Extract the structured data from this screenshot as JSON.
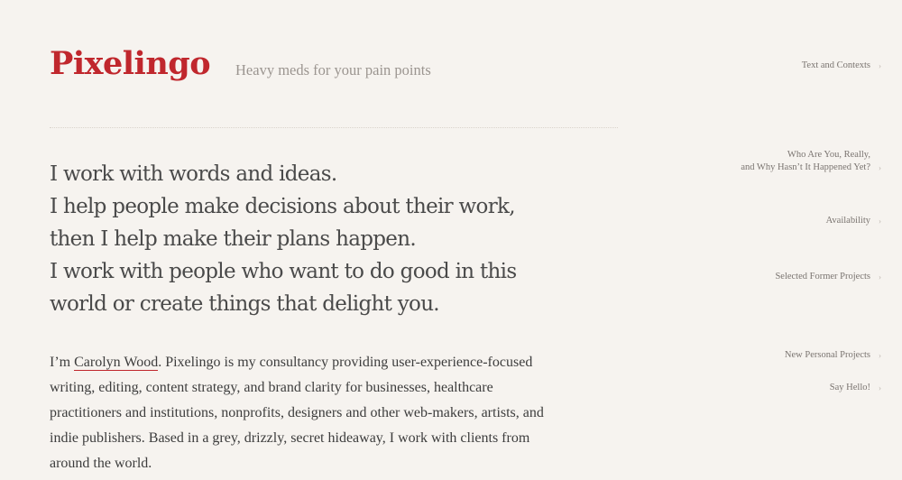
{
  "header": {
    "logo_text": "Pixelingo",
    "tagline": "Heavy meds for your pain points",
    "brand_color": "#c0272d"
  },
  "intro": {
    "lines": [
      "I work with words and ideas.",
      "I help people make decisions about their work,",
      "then I help make their plans happen.",
      "I work with people who want to do good in this",
      "world or create things that delight you."
    ]
  },
  "bio": {
    "prefix": "I’m ",
    "name": "Carolyn Wood",
    "line1_rest": ". Pixelingo is my consultancy providing user-experience-focused",
    "line2": "writing, editing, content strategy, and brand clarity for businesses, healthcare",
    "line3": "practitioners and institutions, nonprofits, designers and other web-makers, artists, and",
    "line4": "indie publishers. Based in a grey, drizzly, secret hideaway, I work with clients from",
    "line5": "around the world."
  },
  "nav": {
    "chevron": "›",
    "items": [
      {
        "lines": [
          "Text and Contexts"
        ]
      },
      {
        "lines": [
          "Who Are You, Really,",
          "and Why Hasn’t It Happened Yet?"
        ]
      },
      {
        "lines": [
          "Availability"
        ]
      },
      {
        "lines": [
          "Selected Former Projects"
        ]
      },
      {
        "lines": [
          "New Personal Projects"
        ]
      },
      {
        "lines": [
          "Say Hello!"
        ]
      }
    ]
  }
}
